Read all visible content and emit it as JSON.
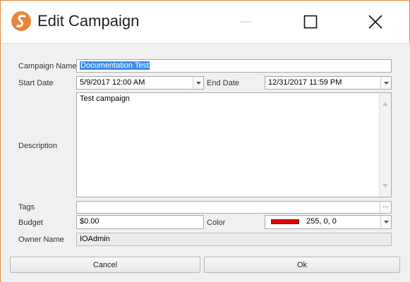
{
  "window": {
    "title": "Edit Campaign",
    "accent_color": "#e8843c"
  },
  "form": {
    "campaign_name": {
      "label": "Campaign Name",
      "value": "Documentation Test"
    },
    "start_date": {
      "label": "Start Date",
      "value": "5/9/2017 12:00 AM"
    },
    "end_date": {
      "label": "End Date",
      "value": "12/31/2017 11:59 PM"
    },
    "description": {
      "label": "Description",
      "value": "Test campaign"
    },
    "tags": {
      "label": "Tags",
      "value": "",
      "browse_label": "..."
    },
    "budget": {
      "label": "Budget",
      "value": "$0.00"
    },
    "color": {
      "label": "Color",
      "value": "255, 0, 0",
      "swatch": "#e00000"
    },
    "owner_name": {
      "label": "Owner Name",
      "value": "IOAdmin"
    }
  },
  "buttons": {
    "cancel": "Cancel",
    "ok": "Ok"
  }
}
